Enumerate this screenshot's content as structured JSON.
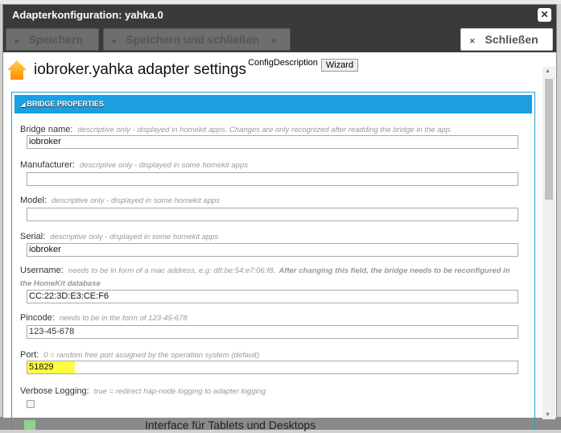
{
  "dialog": {
    "title": "Adapterkonfiguration: yahka.0",
    "close_icon": "close-icon"
  },
  "toolbar": {
    "save": "Speichern",
    "save_close": "Speichern und schließen",
    "close": "Schließen"
  },
  "header": {
    "title": "iobroker.yahka adapter settings",
    "config_description": "ConfigDescription",
    "wizard": "Wizard"
  },
  "panel": {
    "title": "BRIDGE PROPERTIES"
  },
  "fields": [
    {
      "label": "Bridge name:",
      "desc": "descriptive only - displayed in homekit apps. Changes are only recognized after readding the bridge in the app.",
      "value": "iobroker"
    },
    {
      "label": "Manufacturer:",
      "desc": "descriptive only - displayed in some homekit apps",
      "value": ""
    },
    {
      "label": "Model:",
      "desc": "descriptive only - displayed in some homekit apps",
      "value": ""
    },
    {
      "label": "Serial:",
      "desc": "descriptive only - displayed in some homekit apps",
      "value": "iobroker"
    },
    {
      "label": "Username:",
      "desc": "needs to be in form of a mac address, e.g: d8:be:54:e7:06:f8.",
      "desc_bold": "After changing this field, the bridge needs to be reconfigured in the HomeKit database",
      "value": "CC:22:3D:E3:CE:F6"
    },
    {
      "label": "Pincode:",
      "desc": "needs to be in the form of 123-45-678",
      "value": "123-45-678"
    },
    {
      "label": "Port:",
      "desc": "0 = random free port assigned by the operation system (default)",
      "value": "51829",
      "highlight": "#ffff40"
    },
    {
      "label": "Verbose Logging:",
      "desc": "true = redirect hap-node logging to adapter logging",
      "checked": false
    }
  ],
  "background": {
    "text": "Interface für Tablets und Desktops"
  },
  "colors": {
    "accent": "#1b9fe0",
    "titlebar": "#3a3a3a"
  }
}
